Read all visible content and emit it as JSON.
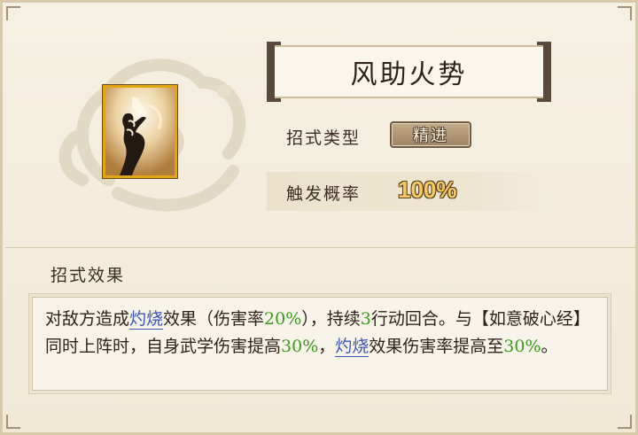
{
  "skill": {
    "name": "风助火势",
    "icon": "flame-hand-icon",
    "type_label": "招式类型",
    "type_value": "精进",
    "rate_label": "触发概率",
    "rate_value": "100%"
  },
  "effect": {
    "section_title": "招式效果",
    "segments": [
      {
        "text": "对敌方造成",
        "style": "normal"
      },
      {
        "text": "灼烧",
        "style": "keyword"
      },
      {
        "text": "效果（伤害率",
        "style": "normal"
      },
      {
        "text": "20%",
        "style": "number"
      },
      {
        "text": "），持续",
        "style": "normal"
      },
      {
        "text": "3",
        "style": "number"
      },
      {
        "text": "行动回合。与【如意破心经】同时上阵时，自身武学伤害提高",
        "style": "normal"
      },
      {
        "text": "30%",
        "style": "number"
      },
      {
        "text": "，",
        "style": "normal"
      },
      {
        "text": "灼烧",
        "style": "keyword"
      },
      {
        "text": "效果伤害率提高至",
        "style": "normal"
      },
      {
        "text": "30%",
        "style": "number"
      },
      {
        "text": "。",
        "style": "normal"
      }
    ]
  },
  "colors": {
    "keyword": "#3d55b8",
    "number": "#3c9a1a",
    "rate": "#f4cb62",
    "icon_border": "#e2a615"
  }
}
